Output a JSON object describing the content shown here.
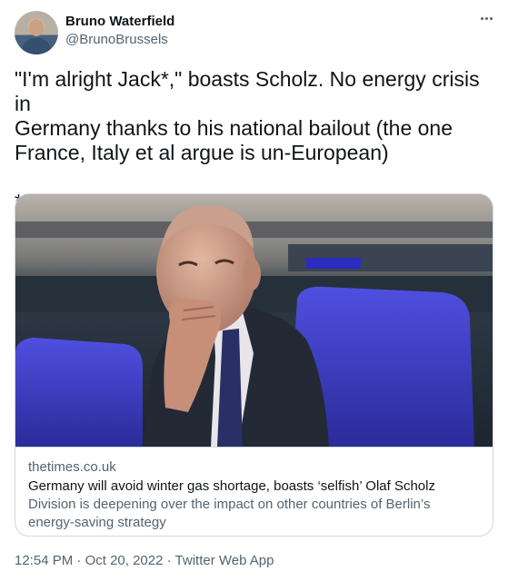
{
  "author": {
    "name": "Bruno Waterfield",
    "handle": "@BrunoBrussels"
  },
  "tweet": {
    "text": "\"I'm alright Jack*,\" boasts Scholz. No energy crisis in\nGermany thanks to his national bailout (the one\nFrance, Italy et al argue is un-European)\n\n*Hans?"
  },
  "card": {
    "domain": "thetimes.co.uk",
    "title": "Germany will avoid winter gas shortage, boasts ‘selfish’ Olaf Scholz",
    "description": "Division is deepening over the impact on other countries of Berlin’s energy-saving strategy"
  },
  "meta": {
    "time": "12:54 PM",
    "separator": " · ",
    "date": "Oct 20, 2022",
    "source": "Twitter Web App"
  },
  "colors": {
    "text_primary": "#0f1419",
    "text_secondary": "#536471",
    "border": "#cfd9de",
    "seat_blue": "#3f3fc6"
  },
  "icons": {
    "more": "more-options-icon"
  }
}
